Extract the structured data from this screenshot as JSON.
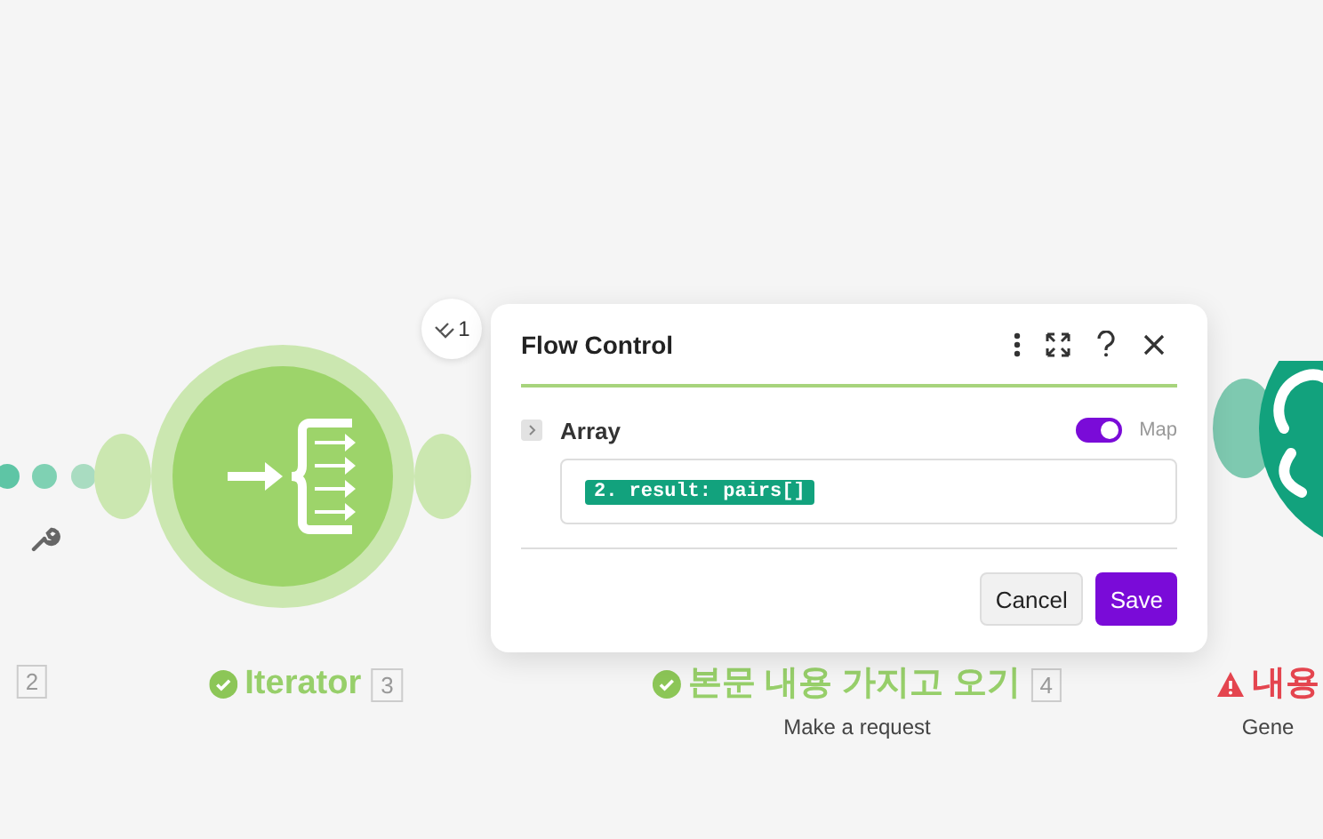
{
  "canvas": {
    "nodes": [
      {
        "kind": "partial",
        "number": "2"
      },
      {
        "kind": "iterator",
        "name": "Iterator",
        "error": false,
        "number": "3",
        "operations": "1"
      },
      {
        "kind": "http",
        "name": "본문 내용 가지고 오기",
        "error": false,
        "number": "4",
        "subtitle": "Make a request"
      },
      {
        "kind": "openai",
        "name": "내용",
        "error": true,
        "subtitle": "Gene"
      }
    ]
  },
  "panel": {
    "title": "Flow Control",
    "field": {
      "label": "Array",
      "expanded": false,
      "map_on": true,
      "map_label": "Map",
      "token": "2. result: pairs[]"
    },
    "buttons": [
      {
        "kind": "secondary",
        "label": "Cancel"
      },
      {
        "kind": "primary",
        "label": "Save"
      }
    ]
  }
}
